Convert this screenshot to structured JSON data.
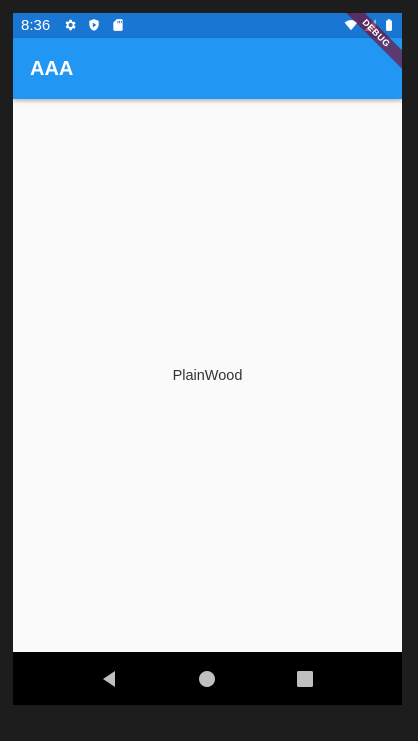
{
  "status_bar": {
    "time": "8:36",
    "icons_left": [
      "gear-icon",
      "play-protect-icon",
      "sd-card-icon"
    ],
    "icons_right": [
      "wifi-icon",
      "signal-icon",
      "battery-icon"
    ]
  },
  "debug_banner": {
    "label": "DEBUG"
  },
  "app_bar": {
    "title": "AAA",
    "color": "#2196f3"
  },
  "body": {
    "text": "PlainWood"
  },
  "nav_bar": {
    "buttons": [
      "back-icon",
      "home-icon",
      "recents-icon"
    ]
  }
}
